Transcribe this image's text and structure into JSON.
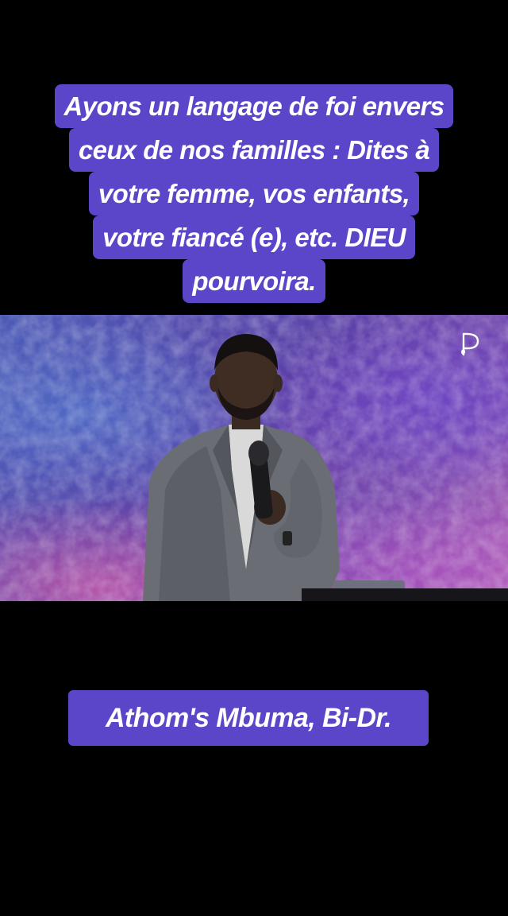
{
  "caption": {
    "lines": [
      "Ayons un langage de foi envers",
      "ceux de nos familles : Dites à",
      "votre femme, vos enfants,",
      "votre fiancé (e), etc. DIEU",
      "pourvoira."
    ]
  },
  "video": {
    "logo_icon": "p-leaf-logo-icon"
  },
  "name_tag": {
    "text": "Athom's Mbuma, Bi-Dr."
  },
  "colors": {
    "background": "#000000",
    "caption_bg": "#5b45c9",
    "caption_text": "#ffffff"
  }
}
